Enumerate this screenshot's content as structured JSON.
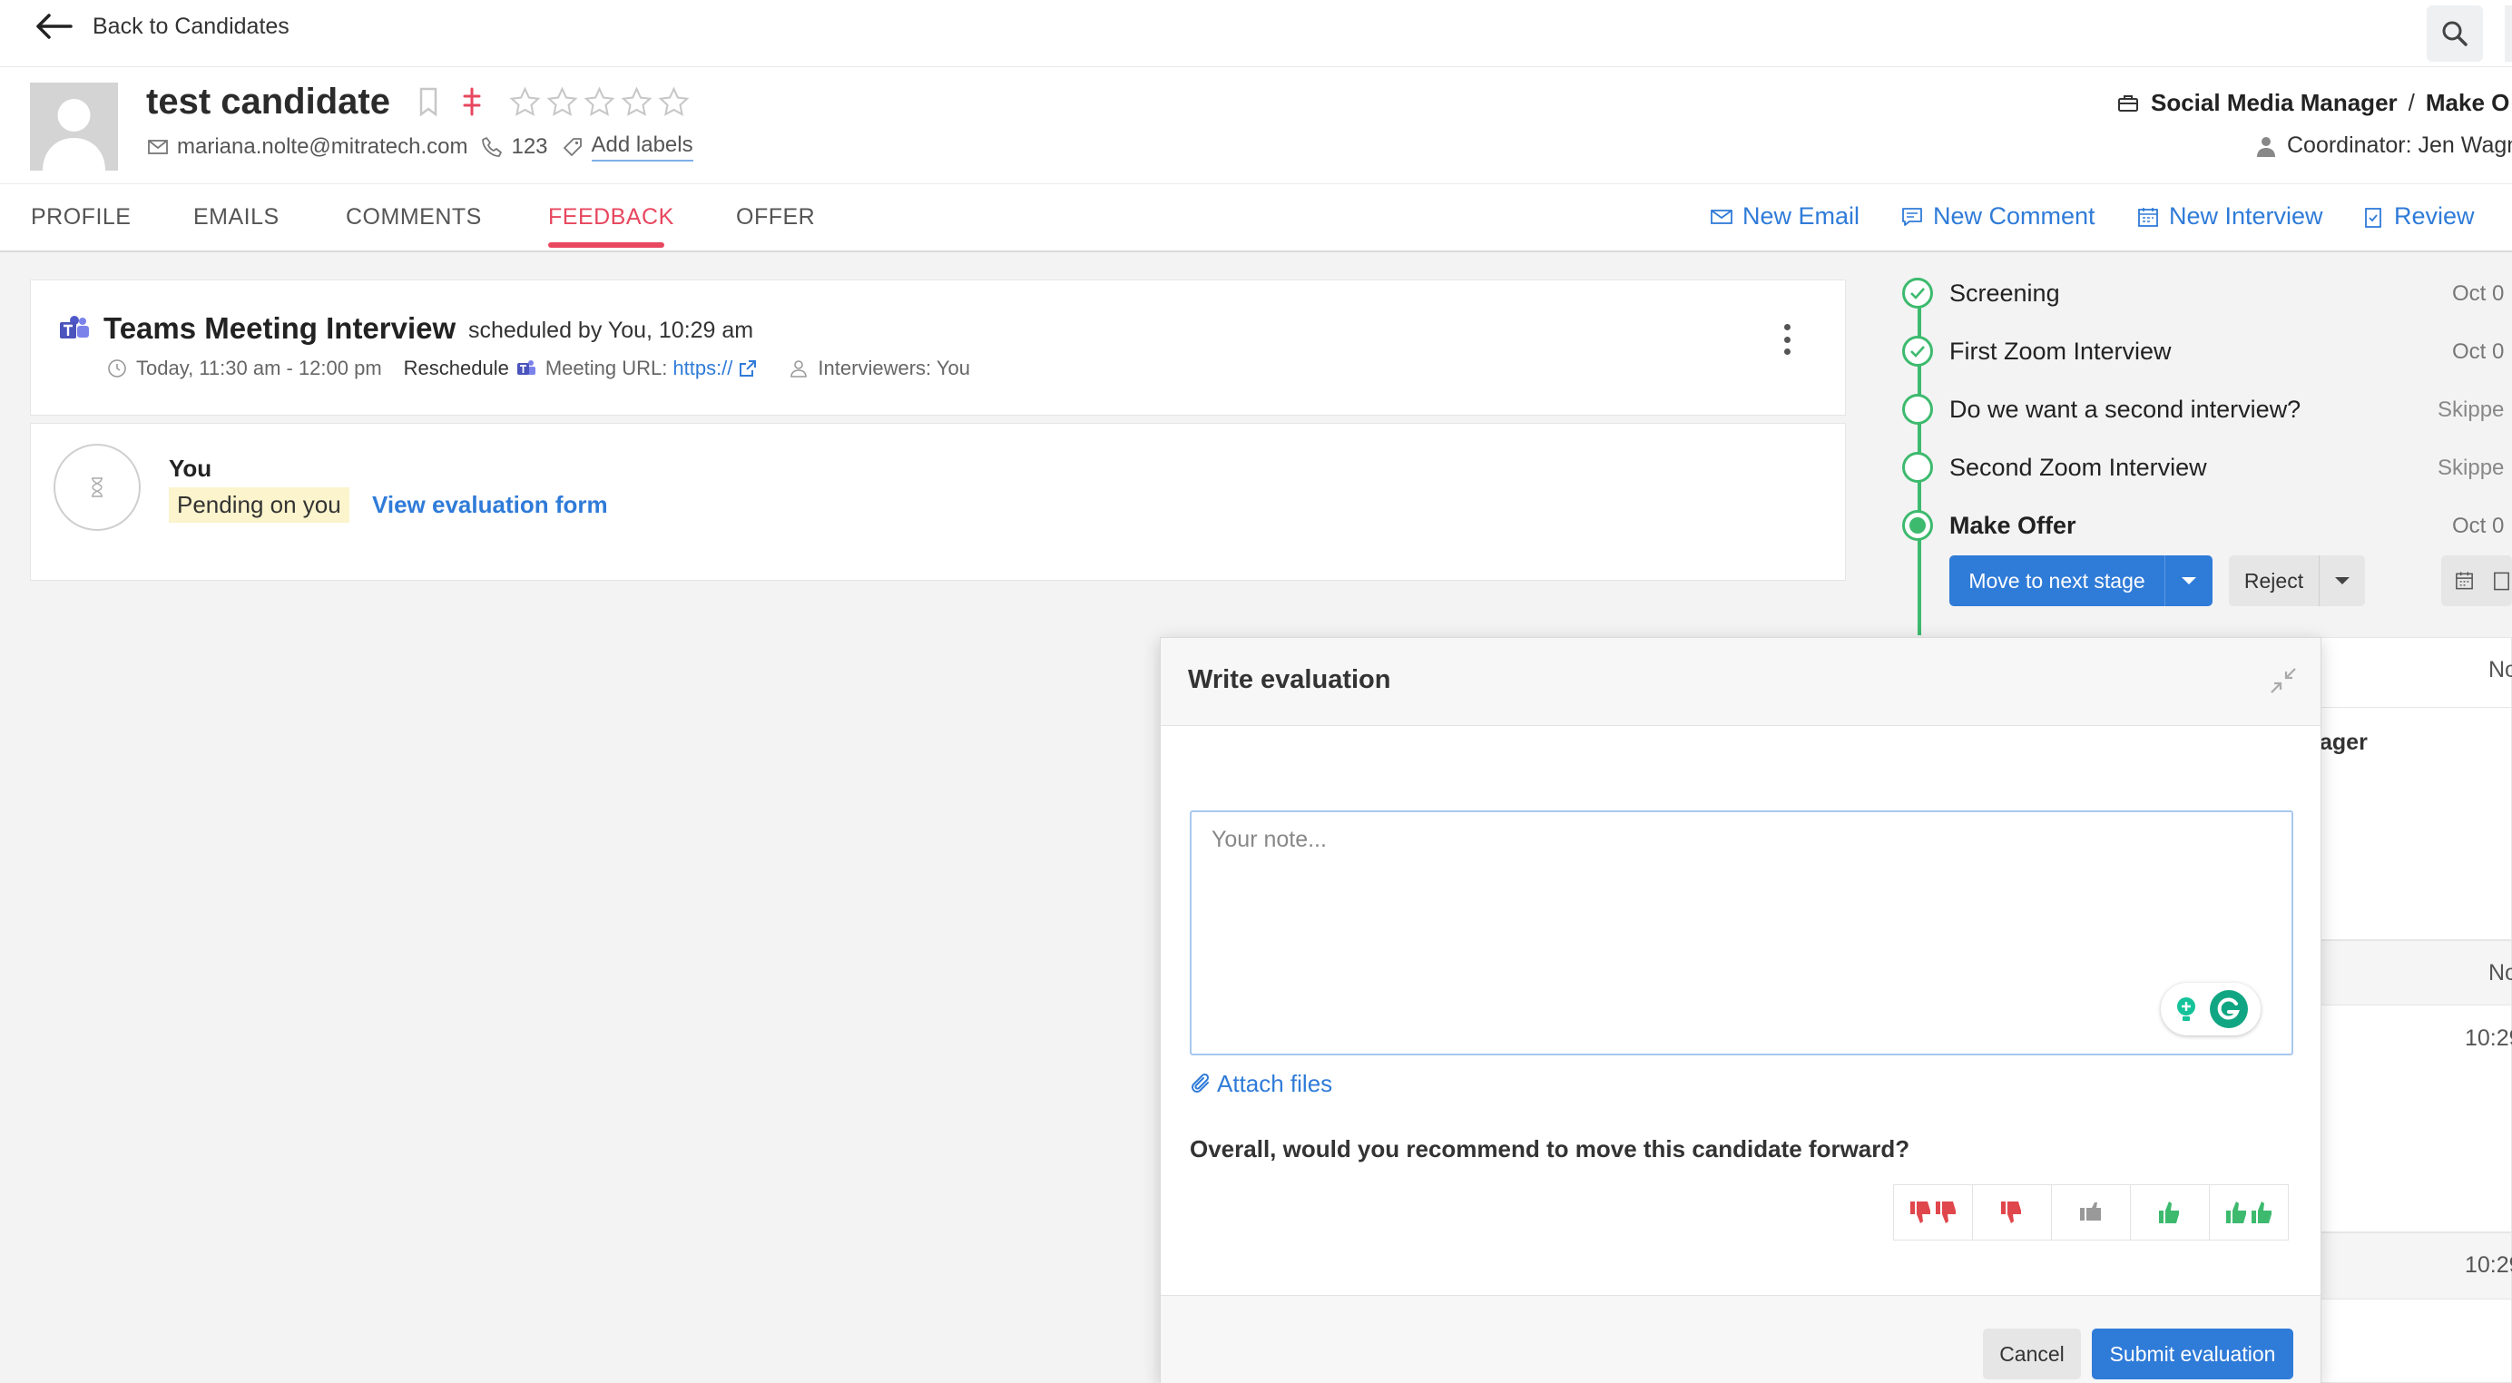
{
  "topbar": {
    "back_label": "Back to Candidates"
  },
  "candidate": {
    "name": "test candidate",
    "email": "mariana.nolte@mitratech.com",
    "phone": "123",
    "add_labels": "Add labels",
    "rating": 0,
    "rating_max": 5
  },
  "job": {
    "title": "Social Media Manager",
    "separator": "/",
    "suffix": "Make O",
    "coordinator": "Coordinator: Jen Wagn"
  },
  "tabs": [
    {
      "label": "PROFILE"
    },
    {
      "label": "EMAILS"
    },
    {
      "label": "COMMENTS"
    },
    {
      "label": "FEEDBACK",
      "active": true
    },
    {
      "label": "OFFER"
    }
  ],
  "actions": {
    "new_email": "New Email",
    "new_comment": "New Comment",
    "new_interview": "New Interview",
    "review": "Review"
  },
  "interview": {
    "title": "Teams Meeting Interview",
    "scheduled": "scheduled by You,  10:29 am",
    "time": "Today, 11:30 am - 12:00 pm",
    "reschedule": "Reschedule",
    "meeting_label": "Meeting URL:",
    "meeting_url": "https://",
    "interviewers": "Interviewers: You"
  },
  "feedback": {
    "name": "You",
    "status": "Pending on you",
    "view_link": "View evaluation form"
  },
  "pipeline": {
    "stages": [
      {
        "name": "Screening",
        "status": "done",
        "date": "Oct 0"
      },
      {
        "name": "First Zoom Interview",
        "status": "done",
        "date": "Oct 0"
      },
      {
        "name": "Do we want a second interview?",
        "status": "skipped",
        "date": "Skippe"
      },
      {
        "name": "Second Zoom Interview",
        "status": "skipped",
        "date": "Skippe"
      },
      {
        "name": "Make Offer",
        "status": "current",
        "date": "Oct 0"
      }
    ],
    "move_label": "Move to next stage",
    "reject_label": "Reject"
  },
  "background_panel": {
    "text1": "No",
    "text2": "ager",
    "text3": "No",
    "text4": "10:29",
    "text5": "10:29"
  },
  "modal": {
    "title": "Write evaluation",
    "note_placeholder": "Your note...",
    "attach_label": "Attach files",
    "question": "Overall, would you recommend to move this candidate forward?",
    "ratings": [
      "strong-no",
      "no",
      "neutral",
      "yes",
      "strong-yes"
    ],
    "cancel_label": "Cancel",
    "submit_label": "Submit evaluation"
  },
  "colors": {
    "accent": "#2f7bd8",
    "active_tab": "#e8475f",
    "stage_green": "#3dba6e",
    "negative": "#e0474c",
    "positive": "#3dba6e",
    "neutral": "#999999"
  }
}
